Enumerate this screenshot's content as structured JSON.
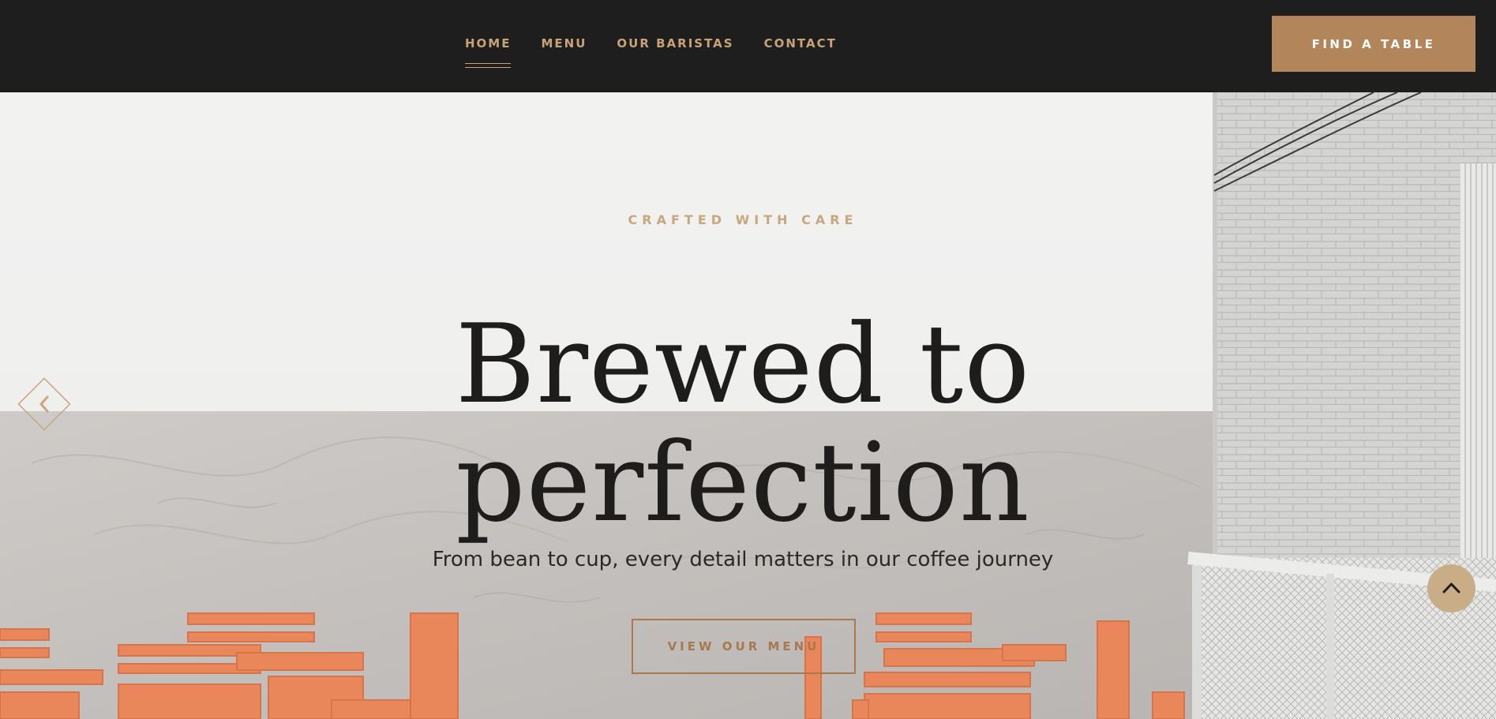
{
  "nav": {
    "items": [
      {
        "label": "HOME",
        "active": true
      },
      {
        "label": "MENU",
        "active": false
      },
      {
        "label": "OUR BARISTAS",
        "active": false
      },
      {
        "label": "CONTACT",
        "active": false
      }
    ],
    "cta_label": "FIND A TABLE"
  },
  "hero": {
    "eyebrow": "CRAFTED WITH CARE",
    "headline_line1": "Brewed to",
    "headline_line2": "perfection",
    "subtitle": "From bean to cup, every detail matters in our coffee journey",
    "button_label": "VIEW OUR MENU"
  },
  "icons": {
    "prev": "chevron-left-icon",
    "scroll_top": "chevron-up-icon"
  },
  "colors": {
    "nav_bg": "#1f1e1e",
    "nav_text": "#c9a275",
    "cta_bg": "#b2865a",
    "headline": "#1e1d1b",
    "eyebrow": "#c9a77c",
    "chair": "#e9865a",
    "scroll_top_bg": "#c8ad87"
  }
}
